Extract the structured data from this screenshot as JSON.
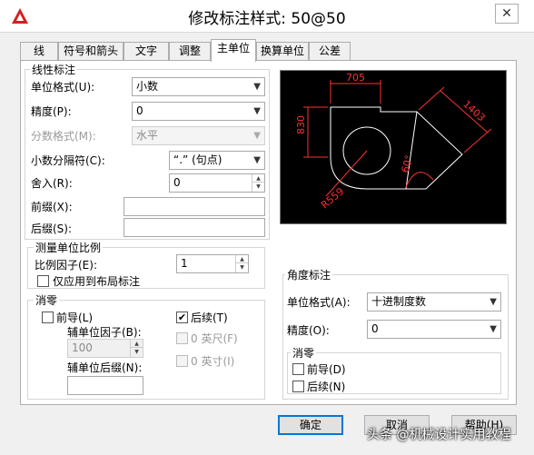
{
  "window": {
    "title": "修改标注样式: 50@50",
    "close_glyph": "✕"
  },
  "tabs": [
    "线",
    "符号和箭头",
    "文字",
    "调整",
    "主单位",
    "换算单位",
    "公差"
  ],
  "linear": {
    "legend": "线性标注",
    "unit_format_label": "单位格式(U):",
    "unit_format_value": "小数",
    "precision_label": "精度(P):",
    "precision_value": "0",
    "fraction_label": "分数格式(M):",
    "fraction_value": "水平",
    "decimal_sep_label": "小数分隔符(C):",
    "decimal_sep_value": "“.” (句点)",
    "roundoff_label": "舍入(R):",
    "roundoff_value": "0",
    "prefix_label": "前缀(X):",
    "prefix_value": "",
    "suffix_label": "后缀(S):",
    "suffix_value": ""
  },
  "measurement_scale": {
    "legend": "测量单位比例",
    "scale_factor_label": "比例因子(E):",
    "scale_factor_value": "1",
    "layout_only_label": "仅应用到布局标注",
    "layout_only_checked": false
  },
  "zero_suppression": {
    "legend": "消零",
    "leading_label": "前导(L)",
    "leading_checked": false,
    "trailing_label": "后续(T)",
    "trailing_checked": true,
    "sub_unit_factor_label": "辅单位因子(B):",
    "sub_unit_factor_value": "100",
    "sub_unit_suffix_label": "辅单位后缀(N):",
    "sub_unit_suffix_value": "",
    "feet_label": "0 英尺(F)",
    "inches_label": "0 英寸(I)",
    "check_glyph": "✔"
  },
  "angular": {
    "legend": "角度标注",
    "unit_format_label": "单位格式(A):",
    "unit_format_value": "十进制度数",
    "precision_label": "精度(O):",
    "precision_value": "0",
    "zero_legend": "消零",
    "leading_label": "前导(D)",
    "leading_checked": false,
    "trailing_label": "后续(N)",
    "trailing_checked": false
  },
  "preview": {
    "dim_top": "705",
    "dim_left": "830",
    "dim_right": "1403",
    "dim_angle": "60°",
    "dim_radius": "R559"
  },
  "buttons": {
    "ok": "确定",
    "cancel": "取消",
    "help": "帮助(H)"
  },
  "watermark": "头条 @机械设计实用教程",
  "colors": {
    "accent": "#0078d7",
    "preview_bg": "#000000",
    "preview_lines": "#ffffff",
    "dim_lines": "#ff3030",
    "logo": "#d42020"
  }
}
